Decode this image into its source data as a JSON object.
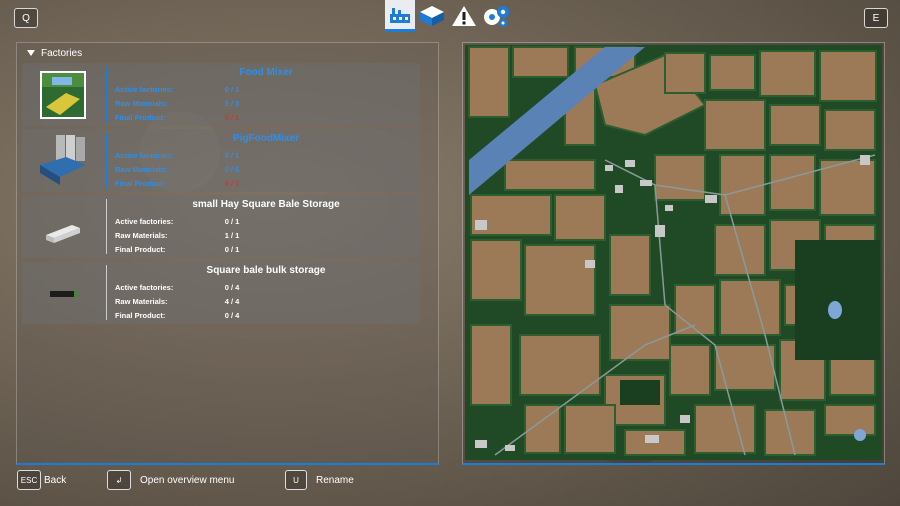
{
  "topbar": {
    "left_key": "Q",
    "right_key": "E",
    "tabs": [
      {
        "icon": "factory-icon",
        "active": true
      },
      {
        "icon": "storage-icon",
        "active": false
      },
      {
        "icon": "warning-icon",
        "active": false
      },
      {
        "icon": "settings-gears-icon",
        "active": false
      }
    ]
  },
  "panel": {
    "header": "Factories",
    "factories": [
      {
        "name": "Food Mixer",
        "highlighted": true,
        "rows": [
          {
            "label": "Active factories:",
            "value": "0 / 1",
            "status": "ok"
          },
          {
            "label": "Raw Materials:",
            "value": "1 / 3",
            "status": "ok"
          },
          {
            "label": "Final Product:",
            "value": "0 / 1",
            "status": "warn"
          }
        ]
      },
      {
        "name": "PigFoodMixer",
        "highlighted": true,
        "rows": [
          {
            "label": "Active factories:",
            "value": "0 / 1",
            "status": "ok"
          },
          {
            "label": "Raw Materials:",
            "value": "0 / 6",
            "status": "ok"
          },
          {
            "label": "Final Product:",
            "value": "0 / 1",
            "status": "warn"
          }
        ]
      },
      {
        "name": "small Hay Square Bale Storage",
        "highlighted": false,
        "rows": [
          {
            "label": "Active factories:",
            "value": "0 / 1",
            "status": "normal"
          },
          {
            "label": "Raw Materials:",
            "value": "1 / 1",
            "status": "normal"
          },
          {
            "label": "Final Product:",
            "value": "0 / 1",
            "status": "normal"
          }
        ]
      },
      {
        "name": "Square bale bulk storage",
        "highlighted": false,
        "rows": [
          {
            "label": "Active factories:",
            "value": "0 / 4",
            "status": "normal"
          },
          {
            "label": "Raw Materials:",
            "value": "4 / 4",
            "status": "normal"
          },
          {
            "label": "Final Product:",
            "value": "0 / 4",
            "status": "normal"
          }
        ]
      }
    ]
  },
  "bottom": {
    "back_key": "ESC",
    "back_label": "Back",
    "overview_key": "↲",
    "overview_label": "Open overview menu",
    "rename_key": "U",
    "rename_label": "Rename"
  },
  "colors": {
    "accent": "#1f7bd8",
    "warn": "#d8342a",
    "field": "#9c7a58",
    "forest": "#1f4a25",
    "water": "#5a82b4"
  }
}
